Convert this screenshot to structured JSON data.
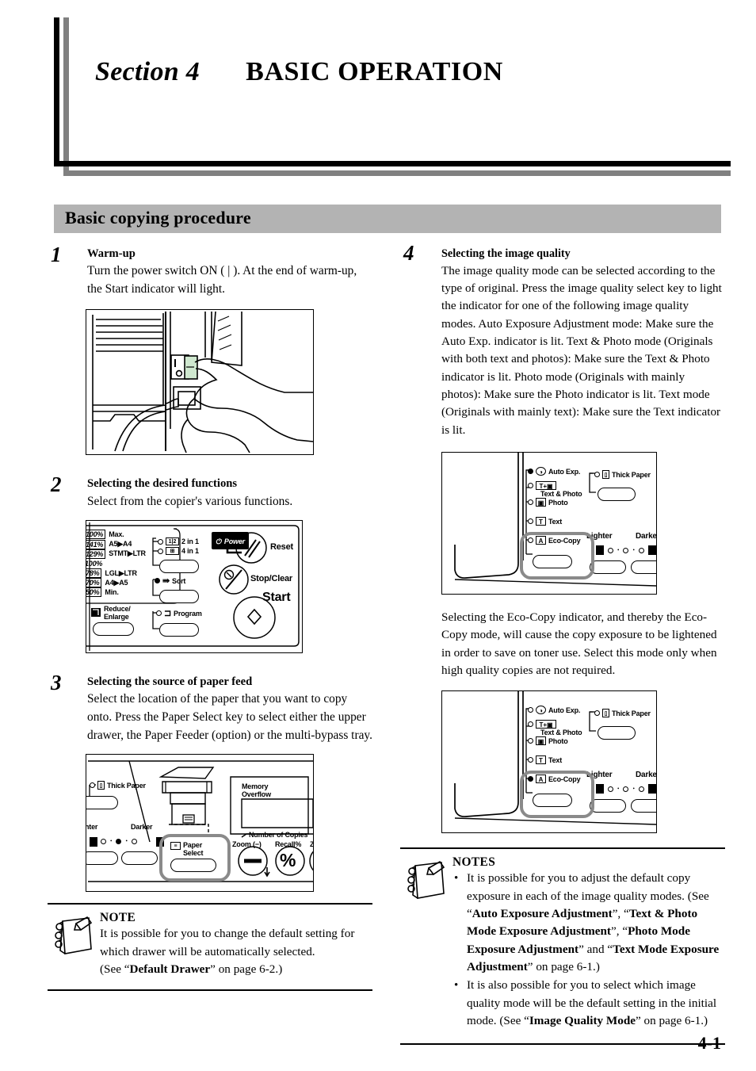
{
  "header": {
    "section_label": "Section 4",
    "section_title": "BASIC OPERATION",
    "bar_heading": "Basic copying procedure"
  },
  "page_number": "4-1",
  "left_column": {
    "steps": [
      {
        "number": "1",
        "title": "Warm-up",
        "text": "Turn the power switch ON ( | ). At the end of warm-up, the Start indicator will light.",
        "figure": "power-switch-illustration"
      },
      {
        "number": "2",
        "title": "Selecting the desired functions",
        "text": "Select from the copier's various functions.",
        "figure": "function-panel-illustration"
      },
      {
        "number": "3",
        "title": "Selecting the source of paper feed",
        "text": "Select the location of the paper that you want to copy onto. Press the Paper Select key to select either the upper drawer, the Paper Feeder (option) or the multi-bypass tray.",
        "figure": "paper-select-panel-illustration"
      }
    ],
    "note": {
      "title": "NOTE",
      "lines": [
        "It is possible for you to change the default setting for which drawer will be automatically selected.",
        "(See “Default Drawer” on page 6-2.)"
      ],
      "bold_ref": "Default Drawer",
      "ref_prefix": "(See “",
      "ref_suffix": "” on page 6-2.)"
    }
  },
  "right_column": {
    "steps": [
      {
        "number": "4",
        "title": "Selecting the image quality",
        "text": "The image quality mode can be selected according to the type of original. Press the image quality select key to light the indicator for one of the following image quality modes. Auto Exposure Adjustment mode: Make sure the Auto Exp. indicator is lit. Text & Photo mode (Originals with both text and photos): Make sure the Text & Photo indicator is lit. Photo mode (Originals with mainly photos): Make sure the Photo indicator is lit. Text mode (Originals with mainly text): Make sure the Text indicator is lit."
      }
    ],
    "eco_text": "Selecting the Eco-Copy indicator, and thereby the Eco-Copy mode, will cause the copy exposure to be lightened in order to save on toner use. Select this mode only when high quality copies are not required.",
    "notes": {
      "title": "NOTES",
      "items": [
        {
          "plain_start": "It is possible for you to adjust the default copy exposure in each of the image quality modes. (See “",
          "bold_1": "Auto Exposure Adjustment",
          "mid_1": "”, “",
          "bold_2": "Text & Photo Mode Exposure Adjustment",
          "mid_2": "”, “",
          "bold_3": "Photo Mode Exposure Adjustment",
          "mid_3": "” and “",
          "bold_4": "Text Mode Exposure Adjustment",
          "plain_end": "” on page 6-1.)"
        },
        {
          "plain_start": "It is also possible for you to select which image quality mode will be the default setting in the initial mode. (See “",
          "bold_1": "Image Quality Mode",
          "plain_end": "” on page 6-1.)"
        }
      ]
    }
  },
  "figures": {
    "function_panel": {
      "name": "copier-function-panel",
      "ratio_rows": [
        {
          "pct": "100%",
          "label": "Max."
        },
        {
          "pct": "141%",
          "label": "A5▶A4"
        },
        {
          "pct": "129%",
          "label": "STMT▶LTR"
        },
        {
          "pct": "100%",
          "label": ""
        },
        {
          "pct": "78%",
          "label": "LGL▶LTR"
        },
        {
          "pct": "70%",
          "label": "A4▶A5"
        },
        {
          "pct": "50%",
          "label": "Min."
        }
      ],
      "reduce_enlarge": "Reduce/\nEnlarge",
      "reduce_enlarge_l1": "Reduce/",
      "reduce_enlarge_l2": "Enlarge",
      "two_in_one": "2 in 1",
      "four_in_one": "4 in 1",
      "two_in_one_icon": "1 2",
      "sort": "Sort",
      "program": "Program",
      "power": "Power",
      "reset": "Reset",
      "stop_clear": "Stop/Clear",
      "stop_clear_icon": "/C",
      "start": "Start"
    },
    "paper_panel": {
      "name": "paper-select-panel",
      "thick_paper": "Thick Paper",
      "lighter": "hter",
      "darker": "Darker",
      "memory_overflow_l1": "Memory",
      "memory_overflow_l2": "Overflow",
      "number_of_copies": "Number of Copies",
      "paper_select_l1": "Paper",
      "paper_select_l2": "Select",
      "zoom_minus": "Zoom (−)",
      "recall": "Recall%",
      "zoom_plus": "Z",
      "percent_key": "%"
    },
    "quality_panel_top": {
      "name": "image-quality-panel-auto-exp-lit",
      "items": [
        {
          "label": "Auto Exp.",
          "lit": true
        },
        {
          "label": "Text & Photo",
          "lit": false
        },
        {
          "label": "Photo",
          "lit": false
        },
        {
          "label": "Text",
          "lit": false
        },
        {
          "label": "Eco-Copy",
          "lit": false
        }
      ],
      "thick_paper": "Thick Paper",
      "lighter": "Lighter",
      "darker": "Darke"
    },
    "quality_panel_bottom": {
      "name": "image-quality-panel-eco-copy-lit",
      "items": [
        {
          "label": "Auto Exp.",
          "lit": false
        },
        {
          "label": "Text & Photo",
          "lit": false
        },
        {
          "label": "Photo",
          "lit": false
        },
        {
          "label": "Text",
          "lit": false
        },
        {
          "label": "Eco-Copy",
          "lit": true
        }
      ],
      "thick_paper": "Thick Paper",
      "lighter": "Lighter",
      "darker": "Darke"
    }
  },
  "colors": {
    "bar_gray": "#b3b3b3",
    "shadow_gray": "#808080",
    "highlight_ring": "#8a8a8a",
    "switch_green": "#cfe8cf"
  }
}
